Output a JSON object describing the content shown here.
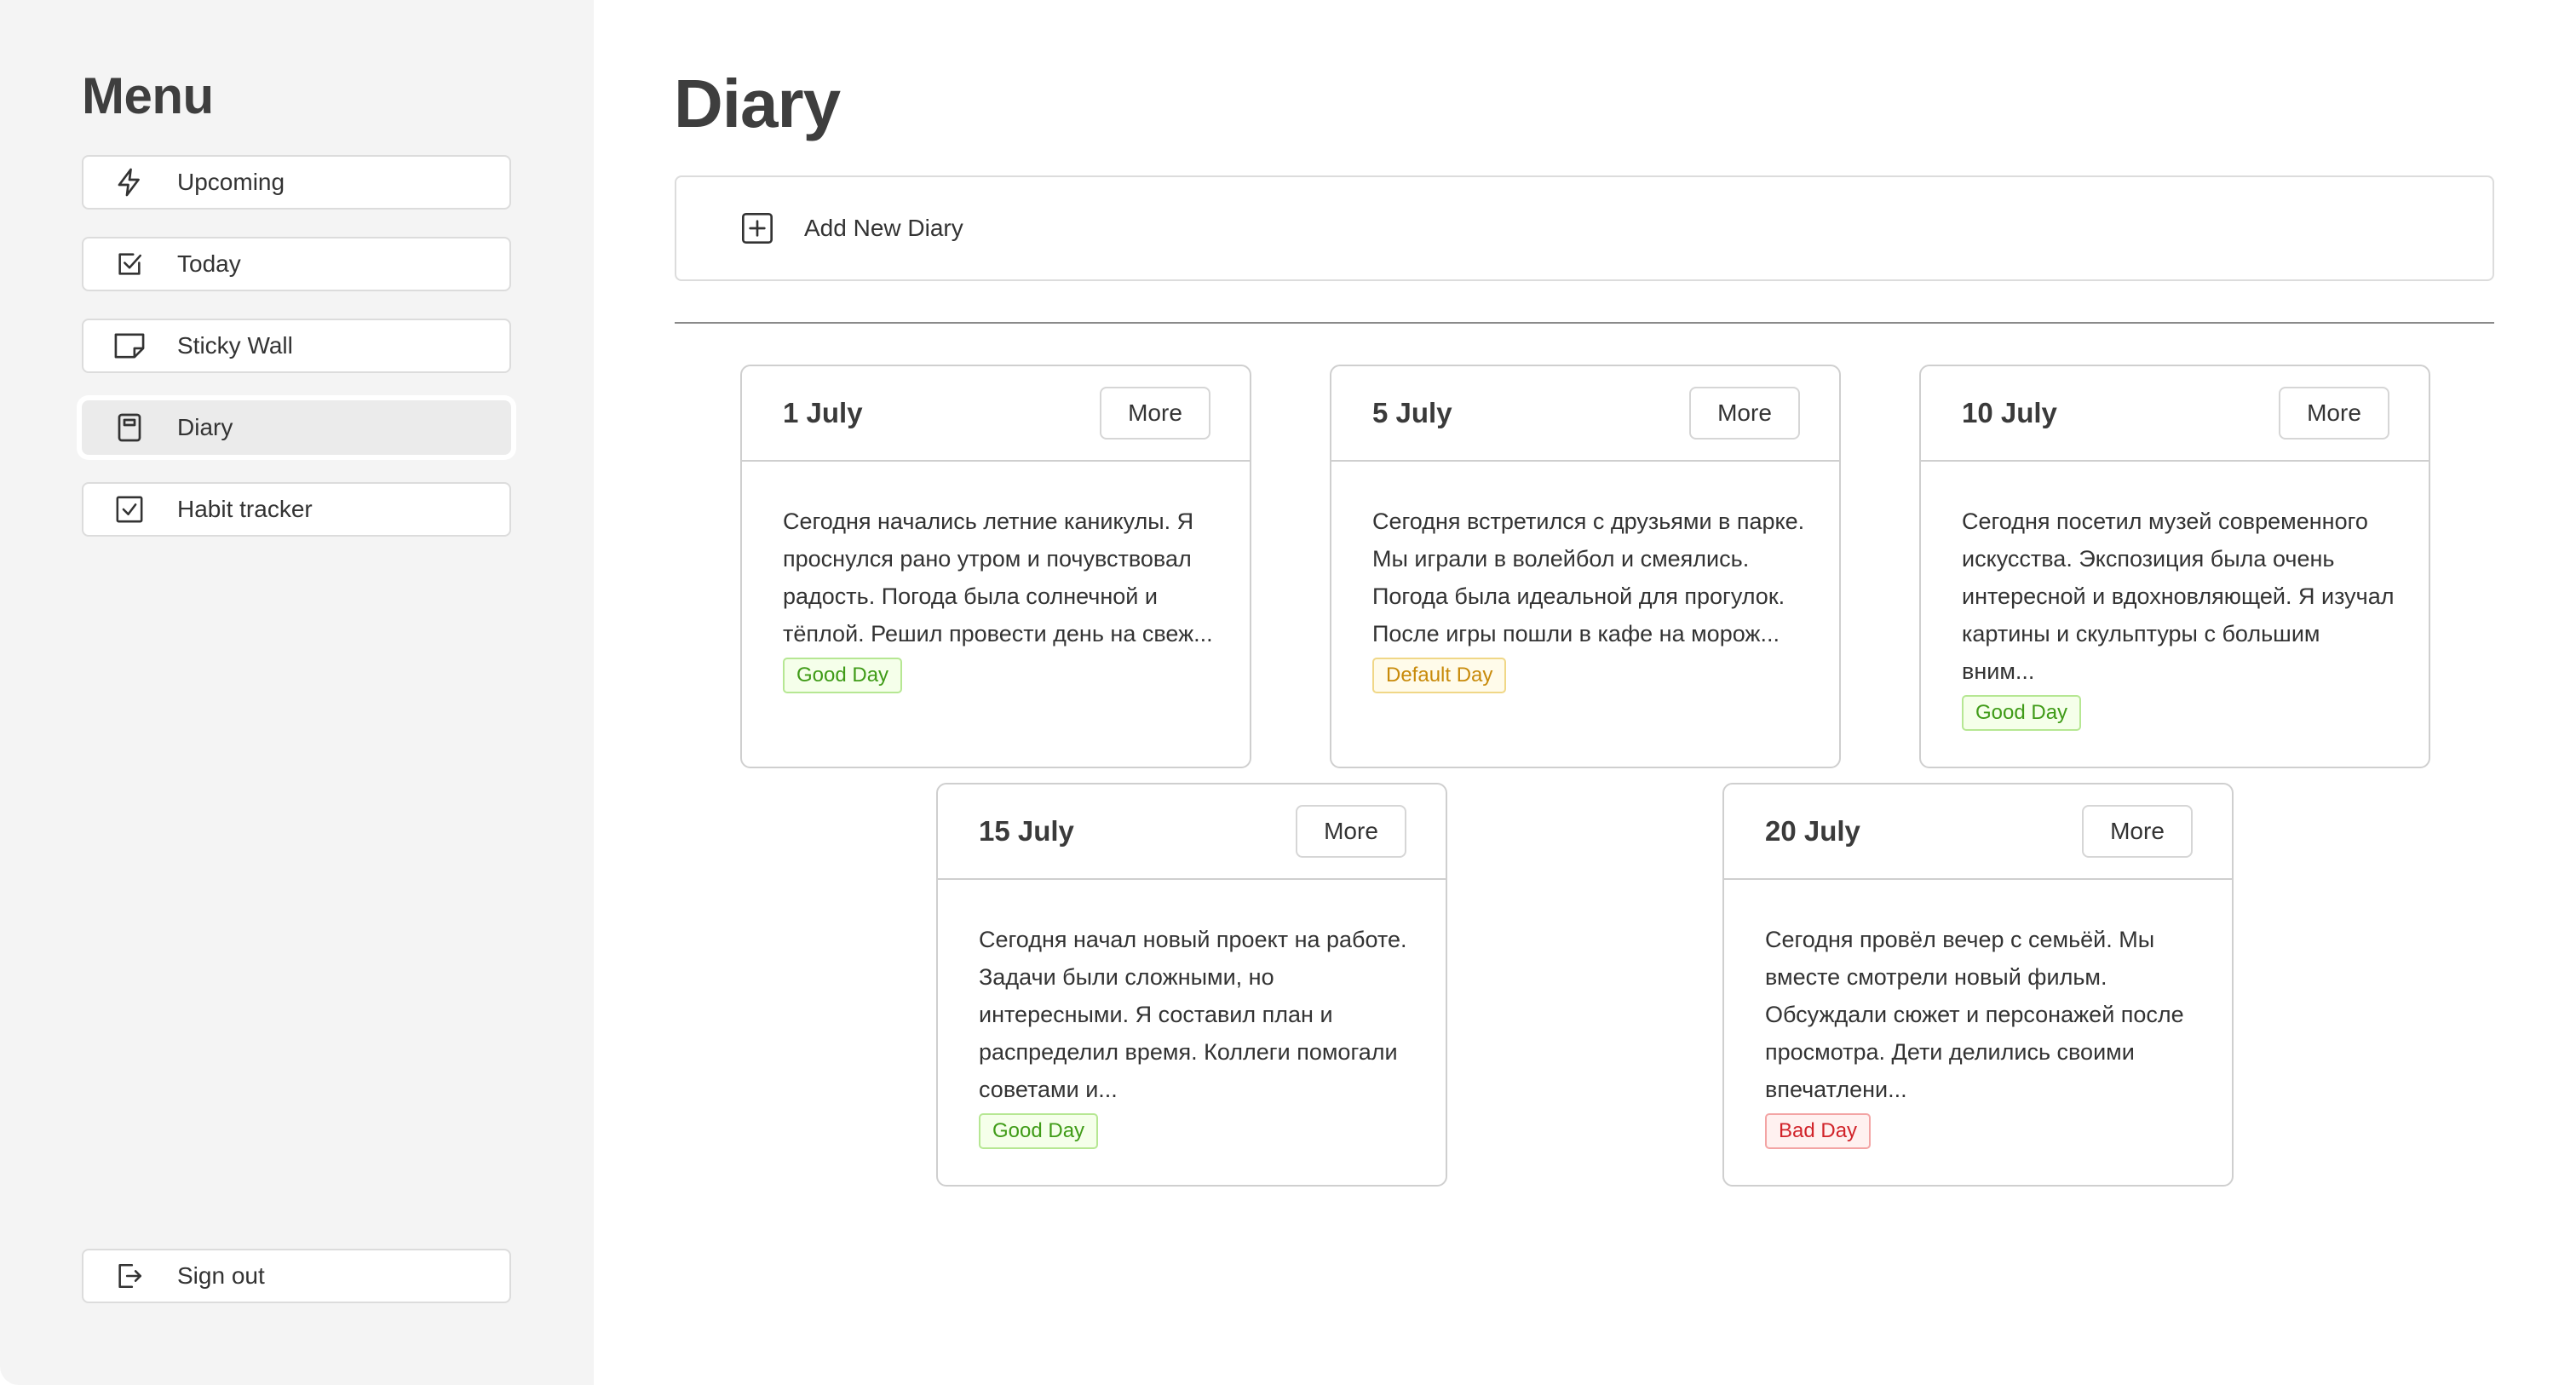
{
  "sidebar": {
    "title": "Menu",
    "items": [
      {
        "label": "Upcoming",
        "icon": "lightning-icon"
      },
      {
        "label": "Today",
        "icon": "checkbox-icon"
      },
      {
        "label": "Sticky Wall",
        "icon": "sticky-note-icon"
      },
      {
        "label": "Diary",
        "icon": "diary-icon",
        "active": true
      },
      {
        "label": "Habit tracker",
        "icon": "check-square-icon"
      }
    ],
    "signout": {
      "label": "Sign out",
      "icon": "sign-out-icon"
    }
  },
  "main": {
    "title": "Diary",
    "add_label": "Add New Diary",
    "more_label": "More",
    "entries": [
      {
        "date": "1 July",
        "text": "Сегодня начались летние каникулы. Я проснулся рано утром и почувствовал радость. Погода была солнечной и тёплой. Решил провести день на свеж...",
        "badge": "Good Day",
        "badge_type": "good"
      },
      {
        "date": "5 July",
        "text": "Сегодня встретился с друзьями в парке. Мы играли в волейбол и смеялись. Погода была идеальной для прогулок. После игры пошли в кафе на морож...",
        "badge": "Default Day",
        "badge_type": "default"
      },
      {
        "date": "10 July",
        "text": "Сегодня посетил музей современного искусства. Экспозиция была очень интересной и вдохновляющей. Я изучал картины и скульптуры с большим вним...",
        "badge": "Good Day",
        "badge_type": "good"
      },
      {
        "date": "15 July",
        "text": "Сегодня начал новый проект на работе. Задачи были сложными, но интересными. Я составил план и распределил время. Коллеги помогали советами и...",
        "badge": "Good Day",
        "badge_type": "good"
      },
      {
        "date": "20 July",
        "text": "Сегодня провёл вечер с семьёй. Мы вместе смотрели новый фильм. Обсуждали сюжет и персонажей после просмотра. Дети делились своими впечатлени...",
        "badge": "Bad Day",
        "badge_type": "bad"
      }
    ]
  },
  "colors": {
    "sidebar_bg": "#f4f4f4",
    "good": "#3f9b17",
    "default": "#c88a0a",
    "bad": "#d1232a"
  }
}
